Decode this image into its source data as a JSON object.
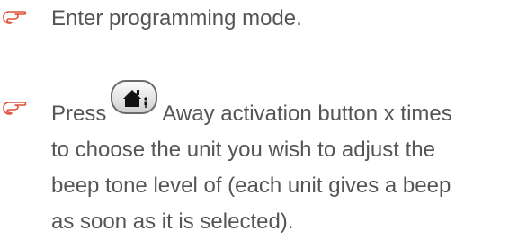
{
  "steps": [
    {
      "icon": "pointing-hand-icon",
      "text": "Enter programming mode."
    },
    {
      "icon": "pointing-hand-icon",
      "text_before_button": "Press",
      "button_icon": "away-activation-button-icon",
      "text_after_button": "Away activation button x times",
      "text_lines": [
        "to choose the unit you wish to adjust the",
        "beep tone level of (each unit gives a beep",
        "as soon as it is selected)."
      ]
    }
  ],
  "colors": {
    "text": "#555555",
    "bullet": "#e0503a"
  }
}
